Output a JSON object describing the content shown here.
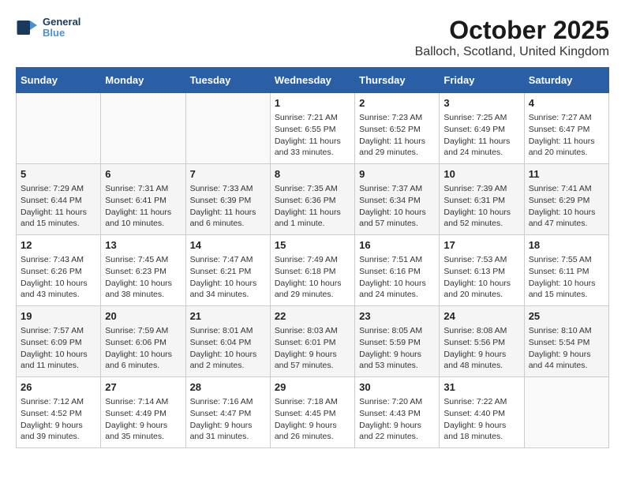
{
  "header": {
    "logo_line1": "General",
    "logo_line2": "Blue",
    "month_title": "October 2025",
    "location": "Balloch, Scotland, United Kingdom"
  },
  "days_of_week": [
    "Sunday",
    "Monday",
    "Tuesday",
    "Wednesday",
    "Thursday",
    "Friday",
    "Saturday"
  ],
  "weeks": [
    [
      {
        "day": "",
        "info": ""
      },
      {
        "day": "",
        "info": ""
      },
      {
        "day": "",
        "info": ""
      },
      {
        "day": "1",
        "info": "Sunrise: 7:21 AM\nSunset: 6:55 PM\nDaylight: 11 hours\nand 33 minutes."
      },
      {
        "day": "2",
        "info": "Sunrise: 7:23 AM\nSunset: 6:52 PM\nDaylight: 11 hours\nand 29 minutes."
      },
      {
        "day": "3",
        "info": "Sunrise: 7:25 AM\nSunset: 6:49 PM\nDaylight: 11 hours\nand 24 minutes."
      },
      {
        "day": "4",
        "info": "Sunrise: 7:27 AM\nSunset: 6:47 PM\nDaylight: 11 hours\nand 20 minutes."
      }
    ],
    [
      {
        "day": "5",
        "info": "Sunrise: 7:29 AM\nSunset: 6:44 PM\nDaylight: 11 hours\nand 15 minutes."
      },
      {
        "day": "6",
        "info": "Sunrise: 7:31 AM\nSunset: 6:41 PM\nDaylight: 11 hours\nand 10 minutes."
      },
      {
        "day": "7",
        "info": "Sunrise: 7:33 AM\nSunset: 6:39 PM\nDaylight: 11 hours\nand 6 minutes."
      },
      {
        "day": "8",
        "info": "Sunrise: 7:35 AM\nSunset: 6:36 PM\nDaylight: 11 hours\nand 1 minute."
      },
      {
        "day": "9",
        "info": "Sunrise: 7:37 AM\nSunset: 6:34 PM\nDaylight: 10 hours\nand 57 minutes."
      },
      {
        "day": "10",
        "info": "Sunrise: 7:39 AM\nSunset: 6:31 PM\nDaylight: 10 hours\nand 52 minutes."
      },
      {
        "day": "11",
        "info": "Sunrise: 7:41 AM\nSunset: 6:29 PM\nDaylight: 10 hours\nand 47 minutes."
      }
    ],
    [
      {
        "day": "12",
        "info": "Sunrise: 7:43 AM\nSunset: 6:26 PM\nDaylight: 10 hours\nand 43 minutes."
      },
      {
        "day": "13",
        "info": "Sunrise: 7:45 AM\nSunset: 6:23 PM\nDaylight: 10 hours\nand 38 minutes."
      },
      {
        "day": "14",
        "info": "Sunrise: 7:47 AM\nSunset: 6:21 PM\nDaylight: 10 hours\nand 34 minutes."
      },
      {
        "day": "15",
        "info": "Sunrise: 7:49 AM\nSunset: 6:18 PM\nDaylight: 10 hours\nand 29 minutes."
      },
      {
        "day": "16",
        "info": "Sunrise: 7:51 AM\nSunset: 6:16 PM\nDaylight: 10 hours\nand 24 minutes."
      },
      {
        "day": "17",
        "info": "Sunrise: 7:53 AM\nSunset: 6:13 PM\nDaylight: 10 hours\nand 20 minutes."
      },
      {
        "day": "18",
        "info": "Sunrise: 7:55 AM\nSunset: 6:11 PM\nDaylight: 10 hours\nand 15 minutes."
      }
    ],
    [
      {
        "day": "19",
        "info": "Sunrise: 7:57 AM\nSunset: 6:09 PM\nDaylight: 10 hours\nand 11 minutes."
      },
      {
        "day": "20",
        "info": "Sunrise: 7:59 AM\nSunset: 6:06 PM\nDaylight: 10 hours\nand 6 minutes."
      },
      {
        "day": "21",
        "info": "Sunrise: 8:01 AM\nSunset: 6:04 PM\nDaylight: 10 hours\nand 2 minutes."
      },
      {
        "day": "22",
        "info": "Sunrise: 8:03 AM\nSunset: 6:01 PM\nDaylight: 9 hours\nand 57 minutes."
      },
      {
        "day": "23",
        "info": "Sunrise: 8:05 AM\nSunset: 5:59 PM\nDaylight: 9 hours\nand 53 minutes."
      },
      {
        "day": "24",
        "info": "Sunrise: 8:08 AM\nSunset: 5:56 PM\nDaylight: 9 hours\nand 48 minutes."
      },
      {
        "day": "25",
        "info": "Sunrise: 8:10 AM\nSunset: 5:54 PM\nDaylight: 9 hours\nand 44 minutes."
      }
    ],
    [
      {
        "day": "26",
        "info": "Sunrise: 7:12 AM\nSunset: 4:52 PM\nDaylight: 9 hours\nand 39 minutes."
      },
      {
        "day": "27",
        "info": "Sunrise: 7:14 AM\nSunset: 4:49 PM\nDaylight: 9 hours\nand 35 minutes."
      },
      {
        "day": "28",
        "info": "Sunrise: 7:16 AM\nSunset: 4:47 PM\nDaylight: 9 hours\nand 31 minutes."
      },
      {
        "day": "29",
        "info": "Sunrise: 7:18 AM\nSunset: 4:45 PM\nDaylight: 9 hours\nand 26 minutes."
      },
      {
        "day": "30",
        "info": "Sunrise: 7:20 AM\nSunset: 4:43 PM\nDaylight: 9 hours\nand 22 minutes."
      },
      {
        "day": "31",
        "info": "Sunrise: 7:22 AM\nSunset: 4:40 PM\nDaylight: 9 hours\nand 18 minutes."
      },
      {
        "day": "",
        "info": ""
      }
    ]
  ]
}
